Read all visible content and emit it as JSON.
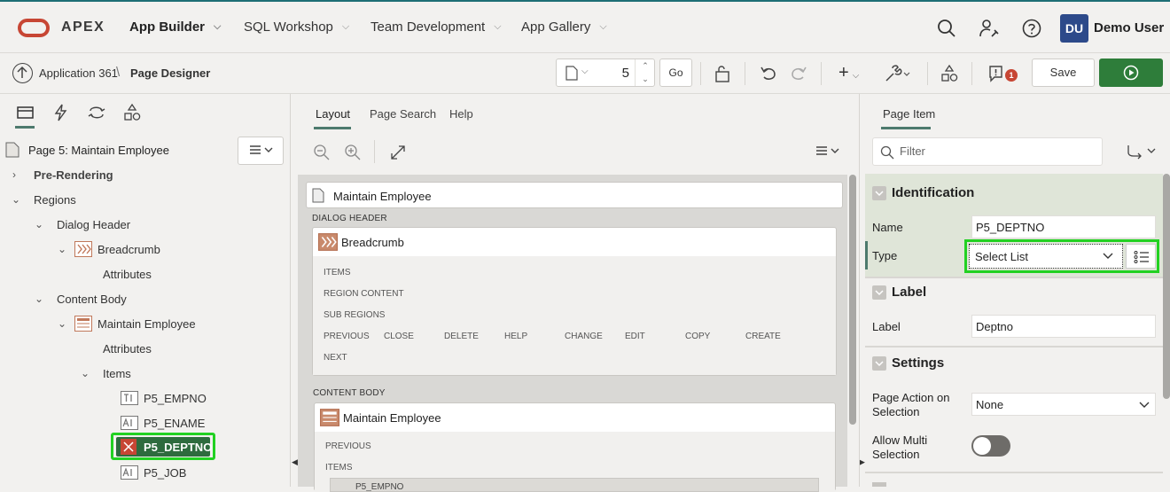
{
  "topnav": {
    "brand": "APEX",
    "items": [
      {
        "label": "App Builder",
        "active": true
      },
      {
        "label": "SQL Workshop"
      },
      {
        "label": "Team Development"
      },
      {
        "label": "App Gallery"
      }
    ],
    "user_initials": "DU",
    "user_name": "Demo User",
    "icons": [
      "search-icon",
      "admin-icon",
      "help-icon"
    ]
  },
  "toolbar": {
    "breadcrumb_app": "Application 361",
    "breadcrumb_sep": "\\",
    "breadcrumb_page": "Page Designer",
    "page_number": "5",
    "go_label": "Go",
    "save_label": "Save",
    "messages_count": "1"
  },
  "left": {
    "tabs": [
      "rendering-tab",
      "dynamic-actions-tab",
      "processing-tab",
      "shared-components-tab"
    ],
    "page_title": "Page 5: Maintain Employee",
    "tree": {
      "pre_rendering": "Pre-Rendering",
      "regions": "Regions",
      "dialog_header": "Dialog Header",
      "breadcrumb": "Breadcrumb",
      "attributes1": "Attributes",
      "content_body": "Content Body",
      "maintain_employee": "Maintain Employee",
      "attributes2": "Attributes",
      "items": "Items",
      "item1": "P5_EMPNO",
      "item2": "P5_ENAME",
      "item3": "P5_DEPTNO",
      "item4": "P5_JOB"
    }
  },
  "center": {
    "tabs": {
      "layout": "Layout",
      "page_search": "Page Search",
      "help": "Help"
    },
    "page_card_title": "Maintain Employee",
    "dialog_header_label": "DIALOG HEADER",
    "breadcrumb_region": "Breadcrumb",
    "slots": {
      "items": "ITEMS",
      "region_content": "REGION CONTENT",
      "sub_regions": "SUB REGIONS",
      "buttons": [
        "PREVIOUS",
        "CLOSE",
        "DELETE",
        "HELP",
        "CHANGE",
        "EDIT",
        "COPY",
        "CREATE"
      ],
      "next": "NEXT"
    },
    "content_body_label": "CONTENT BODY",
    "maintain_region": "Maintain Employee",
    "previous": "PREVIOUS",
    "items_label": "ITEMS",
    "partial_item": "P5_EMPNO"
  },
  "right": {
    "tab": "Page Item",
    "filter_placeholder": "Filter",
    "identification": {
      "title": "Identification",
      "name_label": "Name",
      "name_value": "P5_DEPTNO",
      "type_label": "Type",
      "type_value": "Select List"
    },
    "label_group": {
      "title": "Label",
      "label_label": "Label",
      "label_value": "Deptno"
    },
    "settings": {
      "title": "Settings",
      "page_action_label": "Page Action on Selection",
      "page_action_value": "None",
      "multi_label": "Allow Multi Selection",
      "multi_value": false
    }
  },
  "colors": {
    "accent_green": "#2e7d3a",
    "highlight": "#22d122",
    "brand_red": "#c74634",
    "avatar_blue": "#2d4a8a"
  }
}
